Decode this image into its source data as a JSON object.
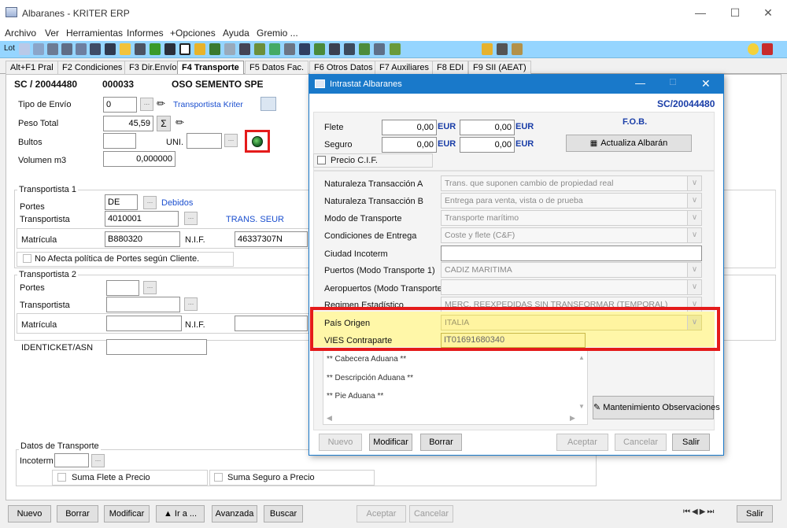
{
  "window": {
    "title": "Albaranes - KRITER ERP"
  },
  "menu": [
    "Archivo",
    "Ver",
    "Herramientas",
    "Informes",
    "+Opciones",
    "Ayuda",
    "Gremio ..."
  ],
  "toolbar": {
    "lot_label": "Lot"
  },
  "tabs": [
    "Alt+F1 Pral",
    "F2 Condiciones",
    "F3 Dir.Envío",
    "F4 Transporte",
    "F5 Datos Fac.",
    "F6 Otros Datos",
    "F7 Auxiliares",
    "F8 EDI",
    "F9 SII (AEAT)"
  ],
  "header": {
    "doc": "SC / 20044480",
    "code": "000033",
    "client": "OSO SEMENTO SPE"
  },
  "main": {
    "tipo_envio_label": "Tipo de Envío",
    "tipo_envio_value": "0",
    "tipo_envio_link": "Transportista Kriter",
    "peso_label": "Peso Total",
    "peso_value": "45,59",
    "sigma": "Σ",
    "bultos_label": "Bultos",
    "uni_label": "UNI.",
    "volumen_label": "Volumen m3",
    "volumen_value": "0,000000",
    "t1_group": "Transportista 1",
    "portes_label": "Portes",
    "portes_value": "DE",
    "portes_link": "Debidos",
    "transp_label": "Transportista",
    "transp_value": "4010001",
    "transp_link": "TRANS. SEUR",
    "matricula_label": "Matrícula",
    "matricula_value": "B880320",
    "nif_label": "N.I.F.",
    "nif_value": "46337307N",
    "no_afecta": "No Afecta política de Portes según Cliente.",
    "t2_group": "Transportista 2",
    "portes2_label": "Portes",
    "transp2_label": "Transportista",
    "matricula2_label": "Matrícula",
    "nif2_label": "N.I.F.",
    "identicket_label": "IDENTICKET/ASN",
    "datos_group": "Datos de Transporte",
    "incoterm_label": "Incoterm",
    "suma_flete": "Suma Flete a Precio",
    "suma_seguro": "Suma Seguro a Precio"
  },
  "dialog": {
    "title": "Intrastat Albaranes",
    "doc": "SC/20044480",
    "flete_label": "Flete",
    "seguro_label": "Seguro",
    "flete_val1": "0,00",
    "flete_val2": "0,00",
    "seguro_val1": "0,00",
    "seguro_val2": "0,00",
    "currency": "EUR",
    "fob": "F.O.B.",
    "actualiza": "Actualiza Albarán",
    "precio_cif": "Precio C.I.F.",
    "rows": [
      {
        "label": "Naturaleza Transacción A",
        "value": "Trans. que suponen cambio de propiedad real"
      },
      {
        "label": "Naturaleza Transacción B",
        "value": "Entrega para venta, vista o de prueba"
      },
      {
        "label": "Modo de Transporte",
        "value": "Transporte marítimo"
      },
      {
        "label": "Condiciones de Entrega",
        "value": "Coste y flete (C&F)"
      },
      {
        "label": "Ciudad Incoterm",
        "value": ""
      },
      {
        "label": "Puertos (Modo Transporte 1)",
        "value": "CADIZ MARITIMA"
      },
      {
        "label": "Aeropuertos (Modo Transporte 4)",
        "value": ""
      },
      {
        "label": "Regimen Estadístico",
        "value": "MERC. REEXPEDIDAS SIN TRANSFORMAR (TEMPORAL)"
      }
    ],
    "pais_label": "País Origen",
    "pais_value": "ITALIA",
    "vies_label": "VIES Contraparte",
    "vies_value": "IT01691680340",
    "obs": [
      "** Cabecera Aduana **",
      "** Descripción Aduana **",
      "** Pie Aduana **"
    ],
    "mant": "Mantenimiento Observaciones",
    "buttons": {
      "nuevo": "Nuevo",
      "modificar": "Modificar",
      "borrar": "Borrar",
      "aceptar": "Aceptar",
      "cancelar": "Cancelar",
      "salir": "Salir"
    }
  },
  "footer": {
    "nuevo": "Nuevo",
    "borrar": "Borrar",
    "modificar": "Modificar",
    "ira": "▲ Ir a ...",
    "avanzada": "Avanzada",
    "buscar": "Buscar",
    "aceptar": "Aceptar",
    "cancelar": "Cancelar",
    "salir": "Salir"
  },
  "colors": {
    "highlight": "#e41b1b",
    "toolbar": "#95d5ff",
    "dialog_title": "#1979ca",
    "selected_field": "#fff7a8"
  }
}
